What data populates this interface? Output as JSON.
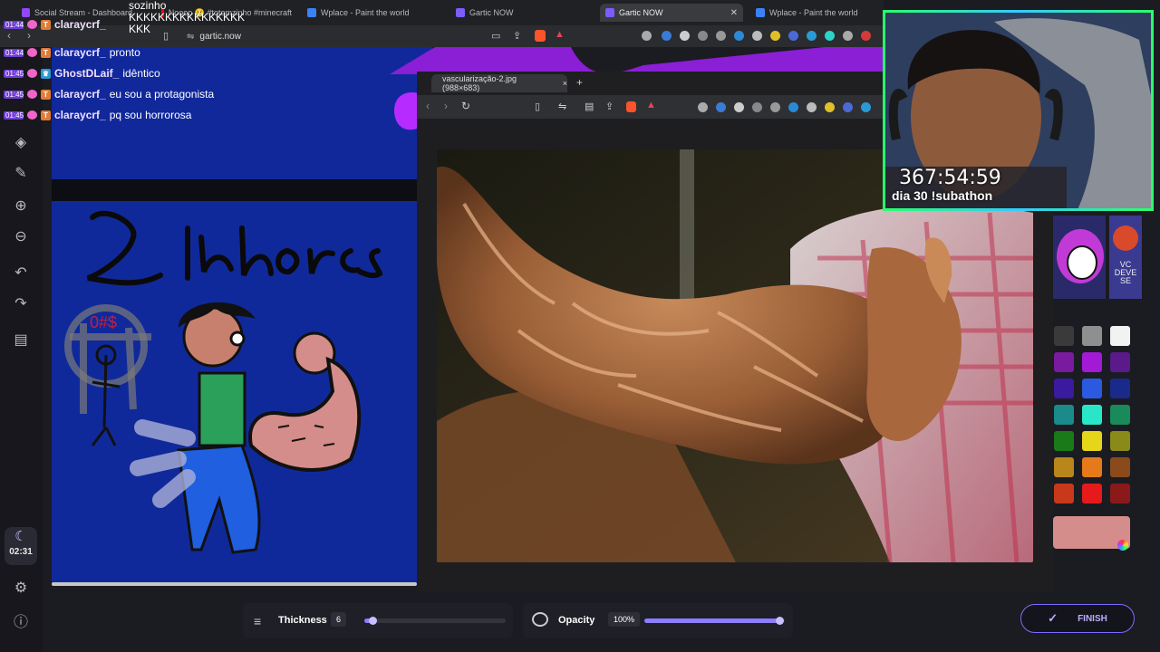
{
  "browser": {
    "tabs": [
      {
        "label": "Social Stream - Dashboard",
        "color": "#9146ff"
      },
      {
        "label": "Noooo 😢 #totemzinho #minecraft",
        "color": "#ff0000"
      },
      {
        "label": "Wplace - Paint the world",
        "color": "#3b82f6"
      },
      {
        "label": "Gartic NOW",
        "color": "#7c5cff"
      },
      {
        "label": "Gartic NOW",
        "color": "#7c5cff",
        "active": true
      },
      {
        "label": "Wplace - Paint the world",
        "color": "#3b82f6"
      }
    ],
    "url": "gartic.now"
  },
  "chat_overlay": {
    "top_text_1": "sozinho",
    "top_text_2": "KKKKKKKKKKKKKKKK",
    "top_text_3": "KKK",
    "messages": [
      {
        "time": "01:44",
        "user": "claraycrf_",
        "text": "pronto"
      },
      {
        "time": "01:45",
        "user": "GhostDLaif_",
        "text": "idêntico"
      },
      {
        "time": "01:45",
        "user": "claraycrf_",
        "text": "eu sou a protagonista"
      },
      {
        "time": "01:45",
        "user": "claraycrf_",
        "text": "pq sou horrorosa"
      }
    ],
    "first_time": "01:44"
  },
  "left_rail": {
    "timer": "02:31"
  },
  "drawing": {
    "word_text": "Linhares"
  },
  "viewer": {
    "tab_title": "vascularização-2.jpg (988×683)",
    "new_tab": "+",
    "close": "×"
  },
  "webcam": {
    "timer": "367:54:59",
    "subtitle": "dia 30 !subathon"
  },
  "avatars": {
    "label": "VC DEVE SE"
  },
  "controls": {
    "thickness_label": "Thickness",
    "thickness_value": "6",
    "thickness_fraction": 0.05,
    "opacity_label": "Opacity",
    "opacity_value": "100%",
    "opacity_fraction": 1.0,
    "finish_label": "FINISH"
  },
  "palette": {
    "colors": [
      "#3a3a3a",
      "#8f8f8f",
      "#f2f2f2",
      "#7a1a9e",
      "#a31ad6",
      "#5a1a8a",
      "#3a1a9e",
      "#2a5ae0",
      "#1a2a8a",
      "#1a8a8a",
      "#2ae6c8",
      "#1a8a5a",
      "#1a7a1a",
      "#e6d61a",
      "#8a8a1a",
      "#b8861a",
      "#e67a1a",
      "#8a4a1a",
      "#c8381a",
      "#e61a1a",
      "#8a1a1a"
    ],
    "selected": "#d48d8a"
  }
}
